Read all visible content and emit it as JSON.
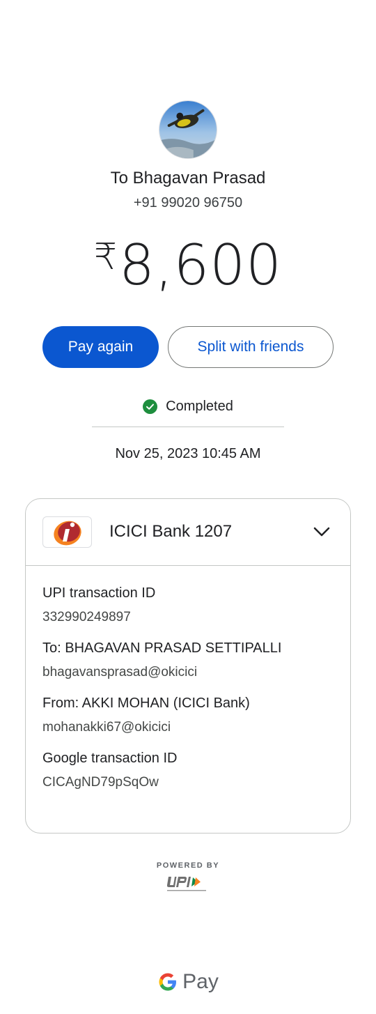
{
  "recipient": {
    "name": "To Bhagavan Prasad",
    "phone": "+91 99020 96750"
  },
  "amount": {
    "currency_symbol": "₹",
    "value": "8,600"
  },
  "actions": {
    "pay_again": "Pay again",
    "split": "Split with friends"
  },
  "status": {
    "label": "Completed",
    "color": "#1e8e3e"
  },
  "datetime": "Nov 25, 2023 10:45 AM",
  "bank": {
    "name": "ICICI Bank 1207",
    "logo_icon": "icici-logo-icon"
  },
  "details": [
    {
      "label": "UPI transaction ID",
      "value": "332990249897"
    },
    {
      "label": "To: BHAGAVAN PRASAD SETTIPALLI",
      "value": "bhagavansprasad@okicici"
    },
    {
      "label": "From: AKKI MOHAN (ICICI Bank)",
      "value": "mohanakki67@okicici"
    },
    {
      "label": "Google transaction ID",
      "value": "CICAgND79pSqOw"
    }
  ],
  "footer": {
    "powered_by": "POWERED BY",
    "gpay_text": "Pay"
  },
  "colors": {
    "primary": "#0b57d0",
    "success": "#1e8e3e"
  }
}
